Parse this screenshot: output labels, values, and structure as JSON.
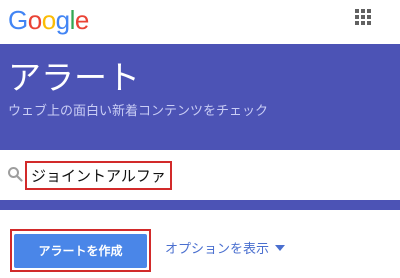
{
  "header": {
    "logo_letters": [
      {
        "char": "G",
        "color": "#4285f4"
      },
      {
        "char": "o",
        "color": "#ea4335"
      },
      {
        "char": "o",
        "color": "#fbbc05"
      },
      {
        "char": "g",
        "color": "#4285f4"
      },
      {
        "char": "l",
        "color": "#34a853"
      },
      {
        "char": "e",
        "color": "#ea4335"
      }
    ],
    "apps_icon": "apps-grid-icon"
  },
  "hero": {
    "title": "アラート",
    "subtitle": "ウェブ上の面白い新着コンテンツをチェック",
    "background": "#4c53b5"
  },
  "search": {
    "icon": "search-icon",
    "value": "ジョイントアルファ"
  },
  "actions": {
    "create_label": "アラートを作成",
    "options_label": "オプションを表示",
    "options_icon": "caret-down-icon",
    "accent": "#4a86e8"
  }
}
